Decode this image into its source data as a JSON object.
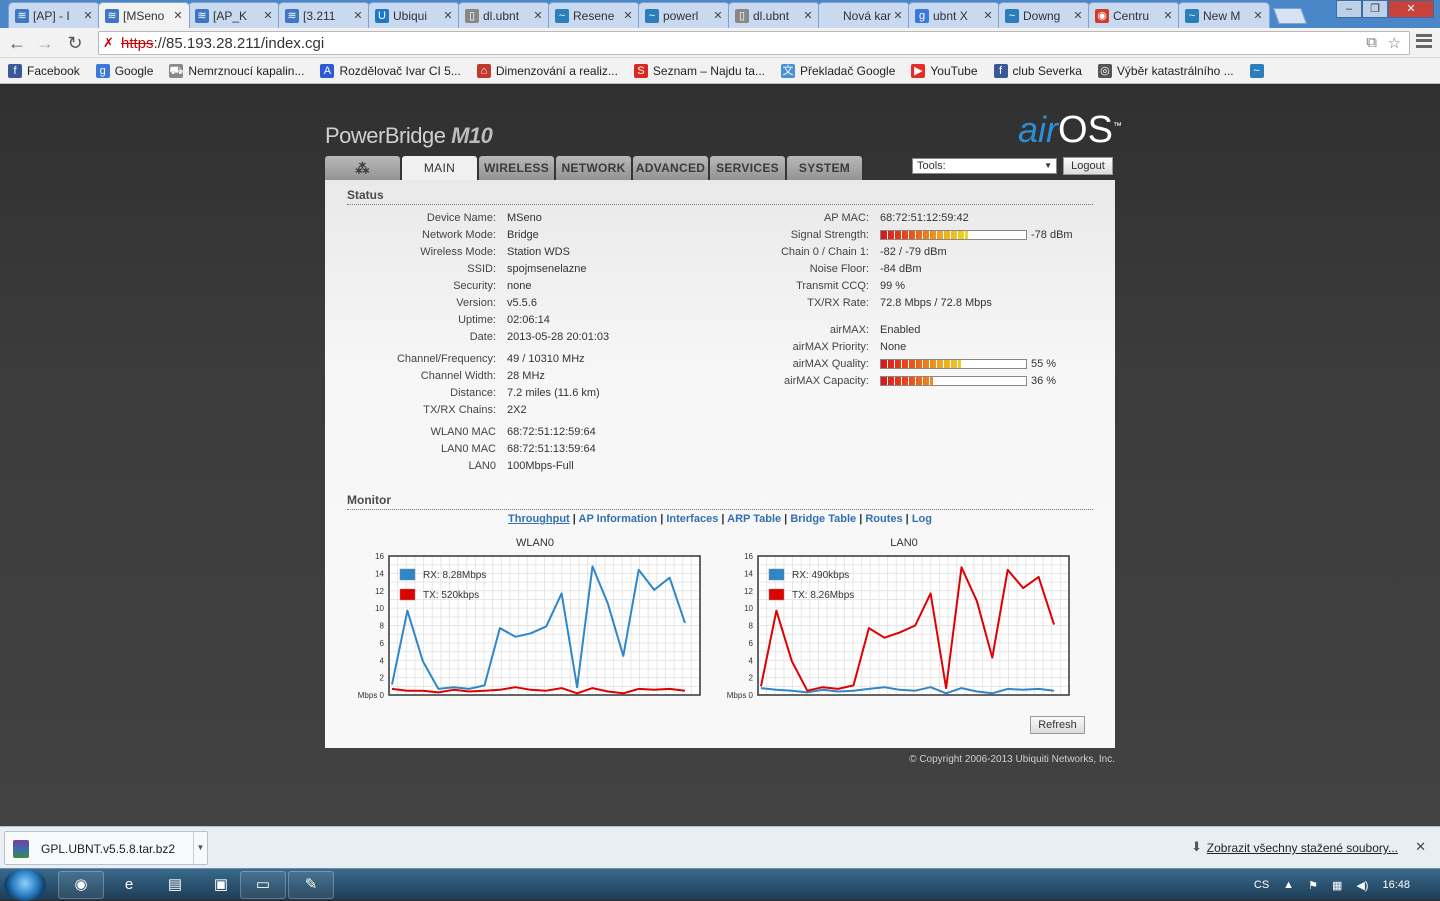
{
  "browser": {
    "tabs": [
      {
        "title": "[AP] - I",
        "icon": "rss-icon",
        "color": "#3e77c3"
      },
      {
        "title": "[MSeno",
        "icon": "rss-icon",
        "color": "#3e77c3",
        "active": true
      },
      {
        "title": "[AP_K",
        "icon": "rss-icon",
        "color": "#3e77c3"
      },
      {
        "title": "[3.211",
        "icon": "rss-icon",
        "color": "#3e77c3"
      },
      {
        "title": "Ubiqui",
        "icon": "ubnt-icon",
        "color": "#1e78c8"
      },
      {
        "title": "dl.ubnt",
        "icon": "page-icon",
        "color": "#888888"
      },
      {
        "title": "Resene",
        "icon": "wave-icon",
        "color": "#2a7fba"
      },
      {
        "title": "powerl",
        "icon": "wave-icon",
        "color": "#2a7fba"
      },
      {
        "title": "dl.ubnt",
        "icon": "page-icon",
        "color": "#888888"
      },
      {
        "title": "Nová kart",
        "icon": "none",
        "color": "#888888"
      },
      {
        "title": "ubnt X",
        "icon": "google-icon",
        "color": "#3c78d8"
      },
      {
        "title": "Downg",
        "icon": "wave-icon",
        "color": "#2a7fba"
      },
      {
        "title": "Centru",
        "icon": "chrome-icon",
        "color": "#d33a2c"
      },
      {
        "title": "New M",
        "icon": "wave-icon",
        "color": "#2a7fba"
      }
    ],
    "url_scheme": "https",
    "url_rest": "://85.193.28.211/index.cgi",
    "bookmarks": [
      {
        "label": "Facebook",
        "icon": "facebook-icon",
        "color": "#3b5998"
      },
      {
        "label": "Google",
        "icon": "google-icon",
        "color": "#3c78d8"
      },
      {
        "label": "Nemrznoucí kapalin...",
        "icon": "cart-icon",
        "color": "#8a8a8a"
      },
      {
        "label": "Rozdělovač Ivar CI 5...",
        "icon": "a-icon",
        "color": "#2b5bd7"
      },
      {
        "label": "Dimenzování a realiz...",
        "icon": "house-icon",
        "color": "#c0392b"
      },
      {
        "label": "Seznam – Najdu ta...",
        "icon": "seznam-icon",
        "color": "#d8281f"
      },
      {
        "label": "Překladač Google",
        "icon": "translate-icon",
        "color": "#4a90d9"
      },
      {
        "label": "YouTube",
        "icon": "youtube-icon",
        "color": "#e52d27"
      },
      {
        "label": "club Severka",
        "icon": "facebook-icon",
        "color": "#3b5998"
      },
      {
        "label": "Výběr katastrálního ...",
        "icon": "globe-icon",
        "color": "#555555"
      },
      {
        "label": "",
        "icon": "wave-icon",
        "color": "#2a7fba"
      }
    ]
  },
  "airos": {
    "product": "PowerBridge",
    "model": "M10",
    "logo_air": "air",
    "logo_os": "OS",
    "logo_tm": "™",
    "tabs": [
      "",
      "MAIN",
      "WIRELESS",
      "NETWORK",
      "ADVANCED",
      "SERVICES",
      "SYSTEM"
    ],
    "tools_label": "Tools:",
    "logout_label": "Logout",
    "status_title": "Status",
    "left_fields": [
      {
        "label": "Device Name:",
        "value": "MSeno"
      },
      {
        "label": "Network Mode:",
        "value": "Bridge"
      },
      {
        "label": "Wireless Mode:",
        "value": "Station WDS"
      },
      {
        "label": "SSID:",
        "value": "spojmsenelazne"
      },
      {
        "label": "Security:",
        "value": "none"
      },
      {
        "label": "Version:",
        "value": "v5.5.6"
      },
      {
        "label": "Uptime:",
        "value": "02:06:14"
      },
      {
        "label": "Date:",
        "value": "2013-05-28 20:01:03"
      },
      {
        "label": "Channel/Frequency:",
        "value": "49 / 10310 MHz"
      },
      {
        "label": "Channel Width:",
        "value": "28 MHz"
      },
      {
        "label": "Distance:",
        "value": "7.2 miles (11.6 km)"
      },
      {
        "label": "TX/RX Chains:",
        "value": "2X2"
      },
      {
        "label": "WLAN0 MAC",
        "value": "68:72:51:12:59:64"
      },
      {
        "label": "LAN0 MAC",
        "value": "68:72:51:13:59:64"
      },
      {
        "label": "LAN0",
        "value": "100Mbps-Full"
      }
    ],
    "right_fields": [
      {
        "label": "AP MAC:",
        "value": "68:72:51:12:59:42"
      },
      {
        "label": "Signal Strength:",
        "value": "-78 dBm",
        "bar": 0.6
      },
      {
        "label": "Chain 0 / Chain 1:",
        "value": "-82 / -79 dBm"
      },
      {
        "label": "Noise Floor:",
        "value": "-84 dBm"
      },
      {
        "label": "Transmit CCQ:",
        "value": "99 %"
      },
      {
        "label": "TX/RX Rate:",
        "value": "72.8 Mbps / 72.8 Mbps"
      },
      {
        "label": "airMAX:",
        "value": "Enabled"
      },
      {
        "label": "airMAX Priority:",
        "value": "None"
      },
      {
        "label": "airMAX Quality:",
        "value": "55 %",
        "bar": 0.55
      },
      {
        "label": "airMAX Capacity:",
        "value": "36 %",
        "bar": 0.36
      }
    ],
    "monitor_title": "Monitor",
    "monitor_links": [
      "Throughput",
      "AP Information",
      "Interfaces",
      "ARP Table",
      "Bridge Table",
      "Routes",
      "Log"
    ],
    "refresh_label": "Refresh",
    "copyright": "© Copyright 2006-2013 Ubiquiti Networks, Inc."
  },
  "chart_data": [
    {
      "type": "line",
      "title": "WLAN0",
      "ylabel": "Mbps",
      "ylim": [
        0,
        16
      ],
      "yticks": [
        0,
        2,
        4,
        6,
        8,
        10,
        12,
        14,
        16
      ],
      "grid": true,
      "legend_position": "top-left",
      "series": [
        {
          "name": "RX: 8.28Mbps",
          "color": "#2f86c8",
          "values": [
            1.2,
            9.7,
            3.9,
            0.7,
            0.9,
            0.7,
            1.1,
            7.7,
            6.7,
            7.1,
            7.9,
            11.7,
            0.9,
            14.8,
            10.5,
            4.5,
            14.4,
            12.1,
            13.5,
            8.3
          ]
        },
        {
          "name": "TX: 520kbps",
          "color": "#e00000",
          "values": [
            0.7,
            0.5,
            0.5,
            0.3,
            0.6,
            0.4,
            0.5,
            0.6,
            0.9,
            0.6,
            0.5,
            0.8,
            0.2,
            0.8,
            0.4,
            0.2,
            0.7,
            0.6,
            0.7,
            0.5
          ]
        }
      ]
    },
    {
      "type": "line",
      "title": "LAN0",
      "ylabel": "Mbps",
      "ylim": [
        0,
        16
      ],
      "yticks": [
        0,
        2,
        4,
        6,
        8,
        10,
        12,
        14,
        16
      ],
      "grid": true,
      "legend_position": "top-left",
      "series": [
        {
          "name": "RX: 490kbps",
          "color": "#2f86c8",
          "values": [
            0.8,
            0.6,
            0.5,
            0.3,
            0.6,
            0.4,
            0.5,
            0.7,
            0.9,
            0.6,
            0.5,
            0.9,
            0.2,
            0.8,
            0.4,
            0.2,
            0.7,
            0.6,
            0.7,
            0.5
          ]
        },
        {
          "name": "TX: 8.26Mbps",
          "color": "#e00000",
          "values": [
            1.0,
            9.7,
            3.9,
            0.5,
            0.9,
            0.7,
            1.1,
            7.7,
            6.6,
            7.2,
            8.0,
            11.7,
            0.8,
            14.7,
            10.8,
            4.3,
            14.4,
            12.3,
            13.6,
            8.1
          ]
        }
      ]
    }
  ],
  "download_shelf": {
    "filename": "GPL.UBNT.v5.5.8.tar.bz2",
    "show_all": "Zobrazit všechny stažené soubory..."
  },
  "taskbar": {
    "lang": "CS",
    "clock": "16:48"
  }
}
